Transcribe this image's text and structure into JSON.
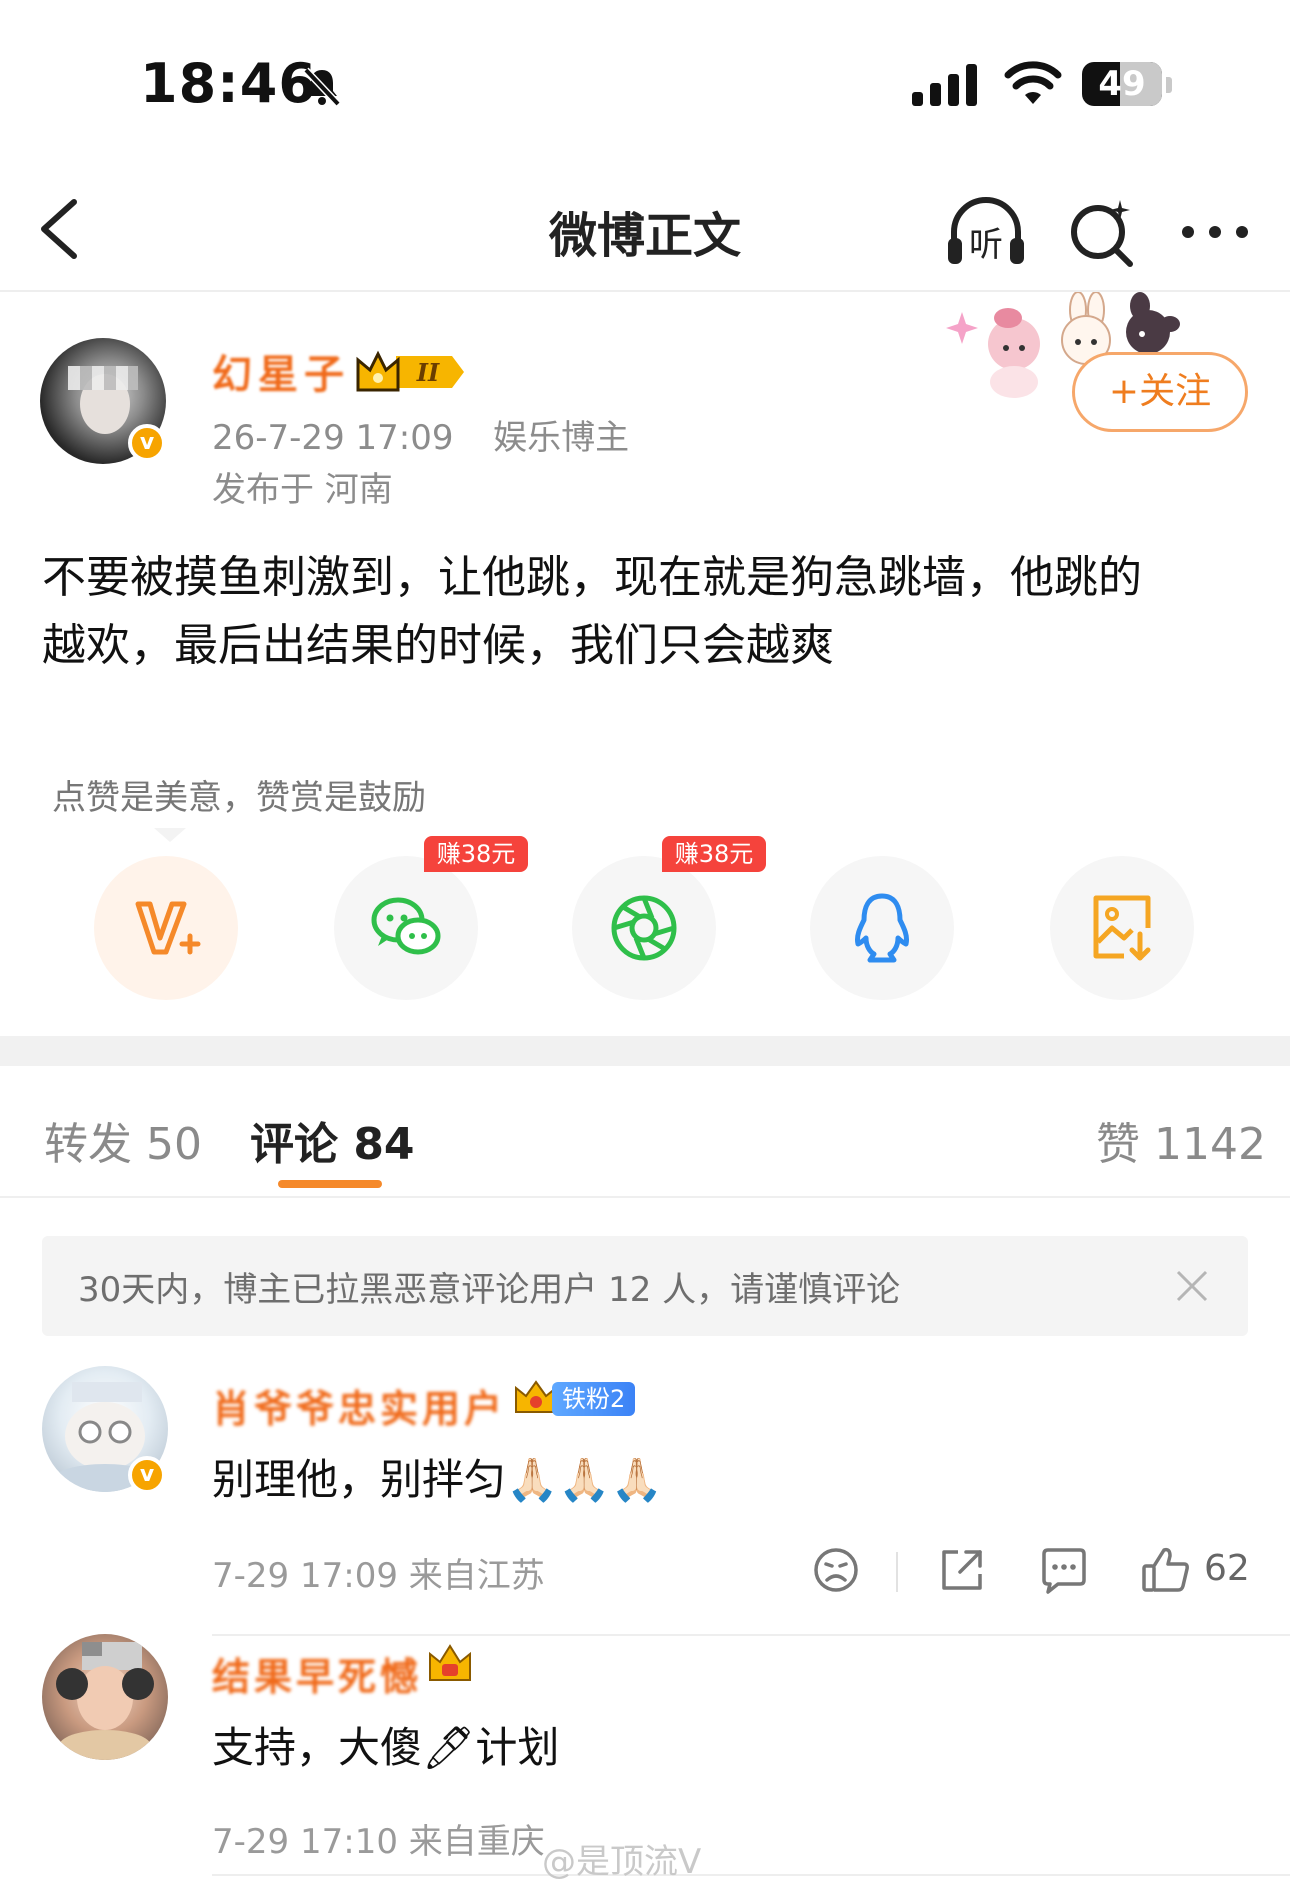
{
  "status_bar": {
    "time": "18:46",
    "battery": "49",
    "icons": [
      "bell-slash-icon",
      "cellular-signal-icon",
      "wifi-icon",
      "battery-icon"
    ]
  },
  "nav": {
    "title": "微博正文",
    "listen_label": "听",
    "icons": [
      "back-arrow-icon",
      "listen-headphone-icon",
      "search-icon",
      "more-icon"
    ]
  },
  "post": {
    "author_name": "幻星子",
    "vip_level": "II",
    "verified_badge": "v",
    "date": "26-7-29 17:09",
    "tag": "娱乐博主",
    "location": "发布于 河南",
    "follow_label": "+关注",
    "text_line1": "不要被摸鱼刺激到，让他跳，现在就是狗急跳墙，他跳的",
    "text_line2": "越欢，最后出结果的时候，我们只会越爽"
  },
  "reward": {
    "hint": "点赞是美意，赞赏是鼓励"
  },
  "share": {
    "items": [
      {
        "name": "reward",
        "icon": "v-plus-reward-icon",
        "badge": ""
      },
      {
        "name": "wechat",
        "icon": "wechat-icon",
        "badge": "赚38元"
      },
      {
        "name": "moments",
        "icon": "wechat-moments-icon",
        "badge": "赚38元"
      },
      {
        "name": "qq",
        "icon": "qq-penguin-icon",
        "badge": ""
      },
      {
        "name": "save-image",
        "icon": "save-image-icon",
        "badge": ""
      }
    ],
    "colors": {
      "reward": "#f5892a",
      "wechat": "#2fbf4a",
      "moments": "#2fbf4a",
      "qq": "#2e8cf0",
      "save": "#f5a623"
    }
  },
  "tabs": {
    "repost": "转发 50",
    "comment": "评论 84",
    "like": "赞 1142"
  },
  "notice": {
    "text": "30天内，博主已拉黑恶意评论用户 12 人，请谨慎评论"
  },
  "comments": [
    {
      "name": "肖爷爷忠实用户",
      "fan_badge": "铁粉2",
      "text": "别理他，别拌匀🙏🏻🙏🏻🙏🏻",
      "meta": "7-29 17:09 来自江苏",
      "likes": "62"
    },
    {
      "name": "结果早死憾",
      "text": "支持，大傻🖊计划",
      "meta": "7-29 17:10 来自重庆"
    }
  ],
  "watermark": "@是顶流V",
  "accent_color": "#f5892a"
}
